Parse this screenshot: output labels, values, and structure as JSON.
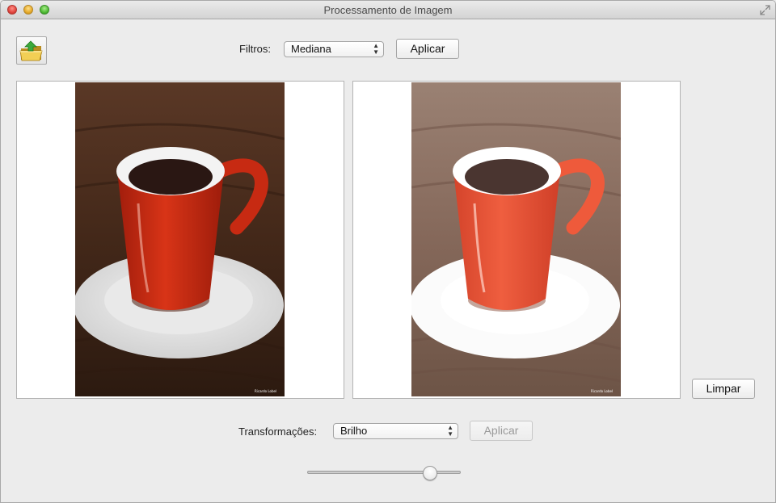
{
  "window": {
    "title": "Processamento de Imagem"
  },
  "toolbar": {
    "open_icon": "folder-open-icon",
    "filters_label": "Filtros:",
    "filters_selected": "Mediana",
    "apply_filter_label": "Aplicar"
  },
  "side": {
    "clear_label": "Limpar"
  },
  "bottom": {
    "transforms_label": "Transformações:",
    "transforms_selected": "Brilho",
    "apply_transform_label": "Aplicar",
    "slider_value": 0.8
  },
  "colors": {
    "window_bg": "#ececec",
    "panel_bg": "#ffffff",
    "cup_red": "#c92a12",
    "wood_dark": "#3a2317"
  },
  "images": {
    "original": {
      "watermark": "Ricardo Lobel"
    },
    "processed": {
      "watermark": "Ricardo Lobel"
    }
  }
}
